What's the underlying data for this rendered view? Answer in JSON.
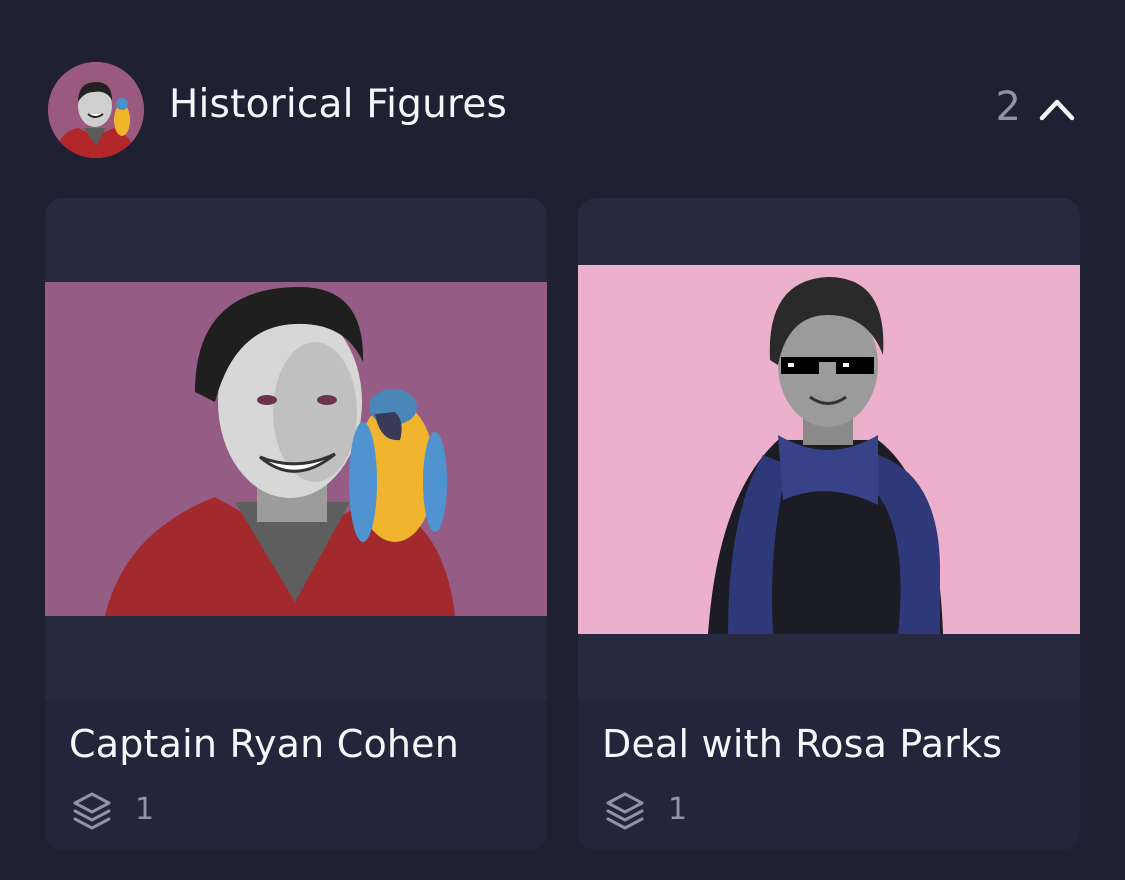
{
  "group": {
    "title": "Historical Figures",
    "count": "2",
    "avatar_icon": "portrait-avatar",
    "collapse_icon": "chevron-up-icon"
  },
  "cards": [
    {
      "title": "Captain Ryan Cohen",
      "layer_count": "1",
      "icon": "layers-icon",
      "background": "#955c85"
    },
    {
      "title": "Deal with Rosa Parks",
      "layer_count": "1",
      "icon": "layers-icon",
      "background": "#ecb0cd"
    }
  ],
  "colors": {
    "page_bg": "#1f2031",
    "card_bg": "#23263a",
    "muted_text": "#8e93a5"
  }
}
